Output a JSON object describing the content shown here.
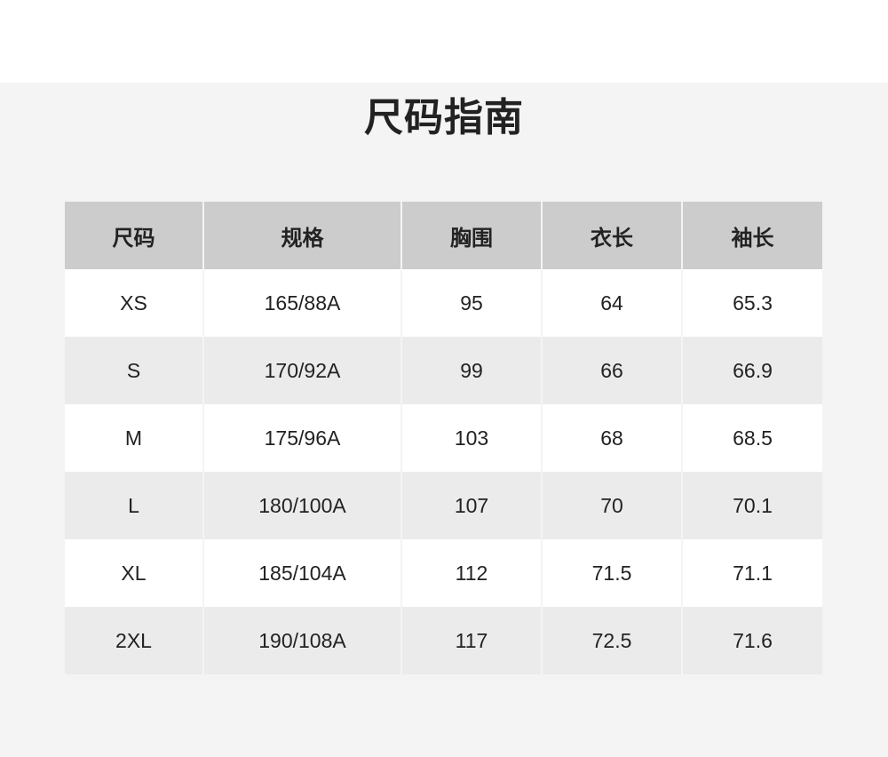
{
  "title": "尺码指南",
  "table": {
    "headers": [
      "尺码",
      "规格",
      "胸围",
      "衣长",
      "袖长"
    ],
    "rows": [
      [
        "XS",
        "165/88A",
        "95",
        "64",
        "65.3"
      ],
      [
        "S",
        "170/92A",
        "99",
        "66",
        "66.9"
      ],
      [
        "M",
        "175/96A",
        "103",
        "68",
        "68.5"
      ],
      [
        "L",
        "180/100A",
        "107",
        "70",
        "70.1"
      ],
      [
        "XL",
        "185/104A",
        "112",
        "71.5",
        "71.1"
      ],
      [
        "2XL",
        "190/108A",
        "117",
        "72.5",
        "71.6"
      ]
    ]
  }
}
